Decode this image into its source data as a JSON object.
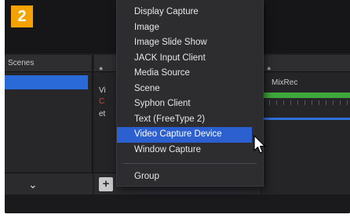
{
  "step_badge": "2",
  "scenes_dock": {
    "title": "Scenes"
  },
  "sources_dock": {
    "rows": [
      "Vi",
      "C",
      "et"
    ],
    "add_button": "+"
  },
  "mixer": {
    "channel_name": "MixRec"
  },
  "context_menu": {
    "items": [
      {
        "label": "Display Capture",
        "highlighted": false
      },
      {
        "label": "Image",
        "highlighted": false
      },
      {
        "label": "Image Slide Show",
        "highlighted": false
      },
      {
        "label": "JACK Input Client",
        "highlighted": false
      },
      {
        "label": "Media Source",
        "highlighted": false
      },
      {
        "label": "Scene",
        "highlighted": false
      },
      {
        "label": "Syphon Client",
        "highlighted": false
      },
      {
        "label": "Text (FreeType 2)",
        "highlighted": false
      },
      {
        "label": "Video Capture Device",
        "highlighted": true
      },
      {
        "label": "Window Capture",
        "highlighted": false
      }
    ],
    "group_label": "Group"
  },
  "colors": {
    "badge": "#f5a200",
    "highlight": "#2c5fd0",
    "meter_green": "#3ea83a"
  },
  "icons": {
    "cursor": "mouse-pointer-icon",
    "chevron": "chevron-down-icon"
  }
}
